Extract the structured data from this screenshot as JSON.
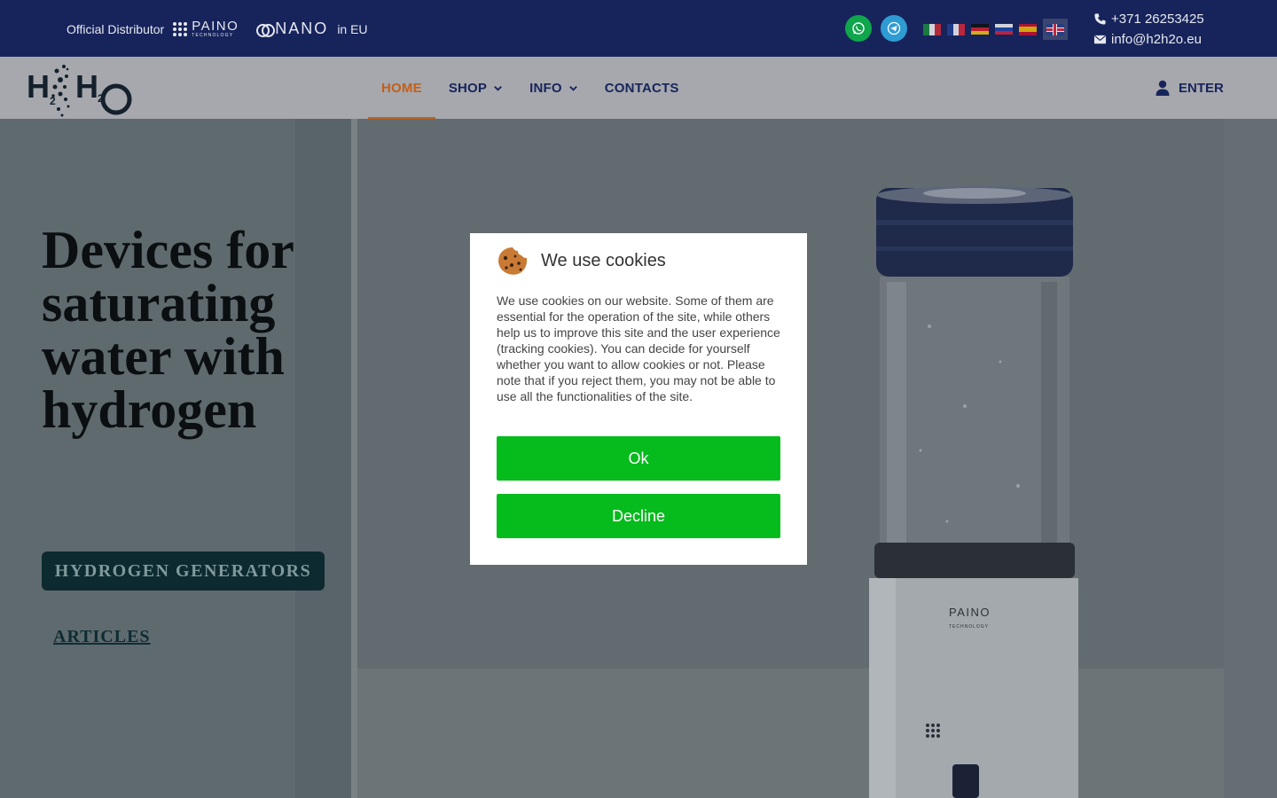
{
  "topbar": {
    "distributor_label": "Official Distributor",
    "paino_brand": "PAINO",
    "paino_sub": "TECHNOLOGY",
    "nano_brand": "NANO",
    "region": "in EU",
    "phone": "+371 26253425",
    "email": "info@h2h2o.eu",
    "languages": [
      "it",
      "fr",
      "de",
      "ru",
      "es",
      "en"
    ],
    "active_language": "en"
  },
  "nav": {
    "items": [
      {
        "label": "HOME",
        "active": true,
        "dropdown": false
      },
      {
        "label": "SHOP",
        "active": false,
        "dropdown": true
      },
      {
        "label": "INFO",
        "active": false,
        "dropdown": true
      },
      {
        "label": "CONTACTS",
        "active": false,
        "dropdown": false
      }
    ],
    "enter_label": "ENTER"
  },
  "hero": {
    "title": "Devices for saturating water with hydrogen",
    "primary_button": "HYDROGEN GENERATORS",
    "secondary_link": "ARTICLES",
    "device_brand": "PAINO",
    "device_brand_sub": "TECHNOLOGY"
  },
  "cookie_modal": {
    "title": "We use cookies",
    "text": "We use cookies on our website. Some of them are essential for the operation of the site, while others help us to improve this site and the user experience (tracking cookies). You can decide for yourself whether you want to allow cookies or not. Please note that if you reject them, you may not be able to use all the functionalities of the site.",
    "ok_label": "Ok",
    "decline_label": "Decline"
  },
  "colors": {
    "topbar_bg": "#17245b",
    "nav_active": "#c45f17",
    "button_green": "#06bb1c",
    "hero_button_bg": "#0c2a30"
  },
  "icons": [
    "whatsapp-icon",
    "telegram-icon",
    "phone-icon",
    "envelope-icon",
    "user-icon",
    "chevron-down-icon",
    "cookie-icon"
  ]
}
